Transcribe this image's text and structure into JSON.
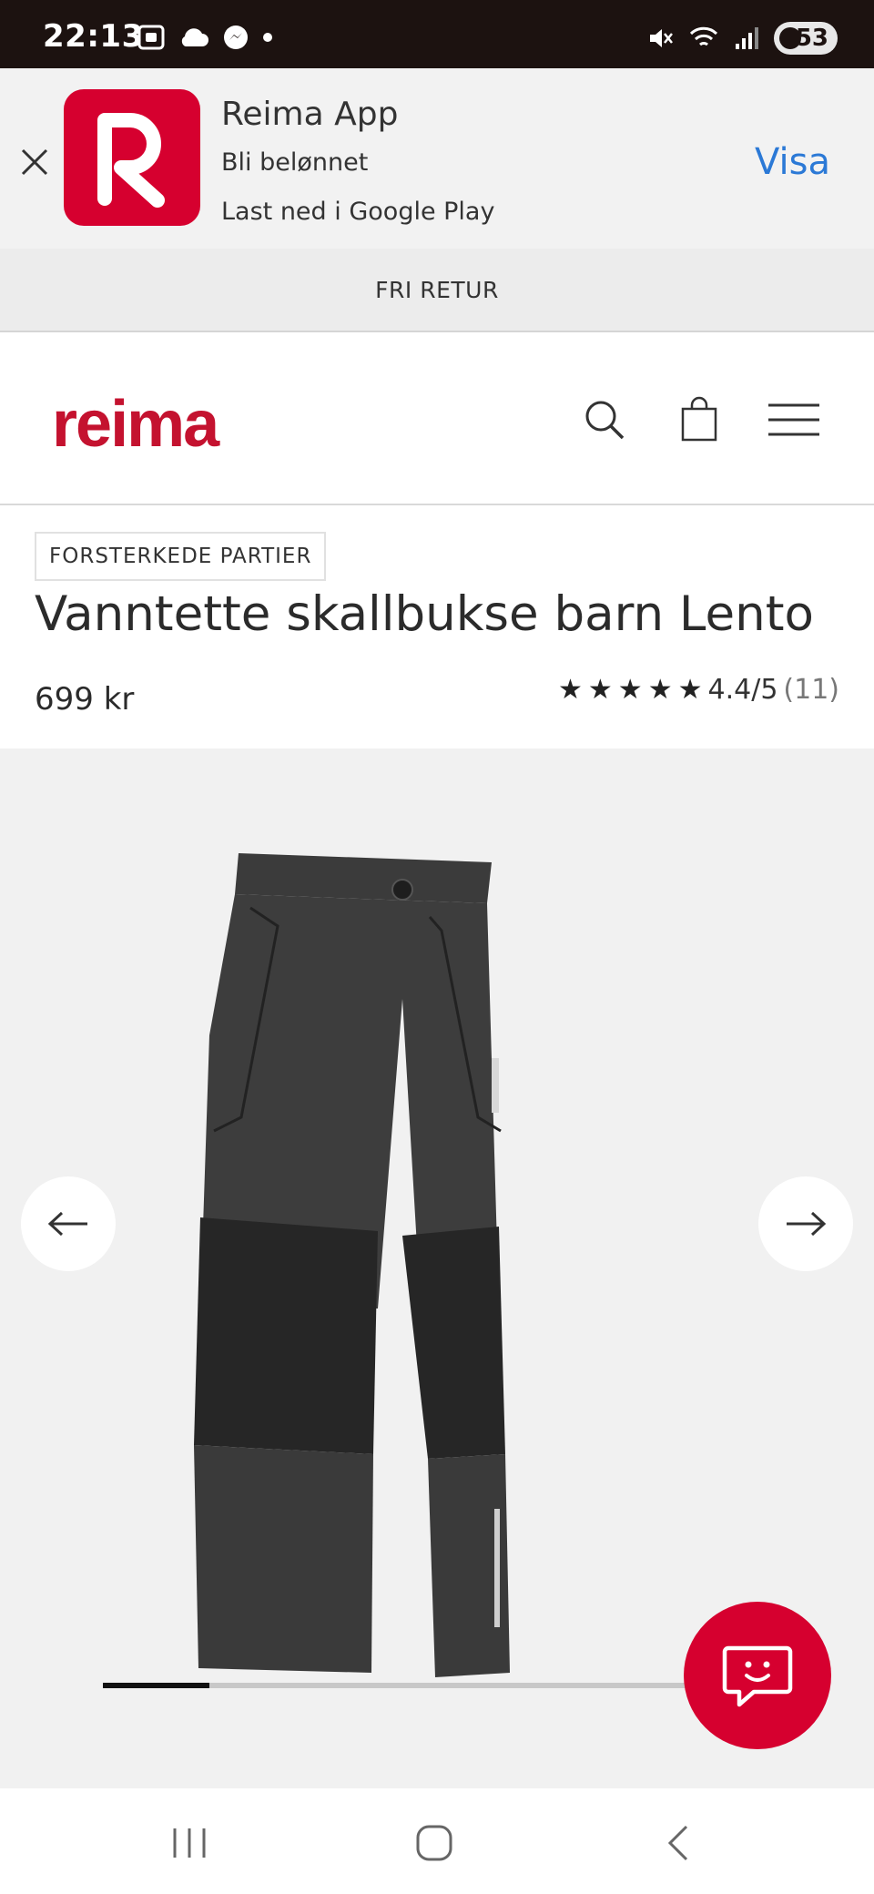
{
  "status_bar": {
    "time": "22:13",
    "battery": "53",
    "icons_left": [
      "screenshot-icon",
      "cloud-icon",
      "messenger-icon",
      "dot-icon"
    ],
    "icons_right": [
      "mute-icon",
      "wifi-icon",
      "signal-icon",
      "battery-icon"
    ]
  },
  "app_banner": {
    "title": "Reima App",
    "subtitle": "Bli belønnet",
    "store_text": "Last ned i Google Play",
    "cta_label": "Visa"
  },
  "promo_bar": {
    "text": "FRI RETUR"
  },
  "header": {
    "logo_text": "reima",
    "icons": [
      "search-icon",
      "bag-icon",
      "menu-icon"
    ]
  },
  "product": {
    "badge": "FORSTERKEDE PARTIER",
    "title": "Vanntette skallbukse barn Lento",
    "price": "699 kr",
    "rating_text": "4.4/5",
    "rating_count": "(11)",
    "rating_value": 4.4,
    "rating_max": 5
  },
  "gallery": {
    "image_fraction_shown": 0.18,
    "prev_icon": "arrow-left-icon",
    "next_icon": "arrow-right-icon"
  },
  "colors": {
    "brand_red": "#d6002f",
    "logo_red": "#c4122f",
    "link_blue": "#2b79d6",
    "status_bar": "#1c1210"
  }
}
